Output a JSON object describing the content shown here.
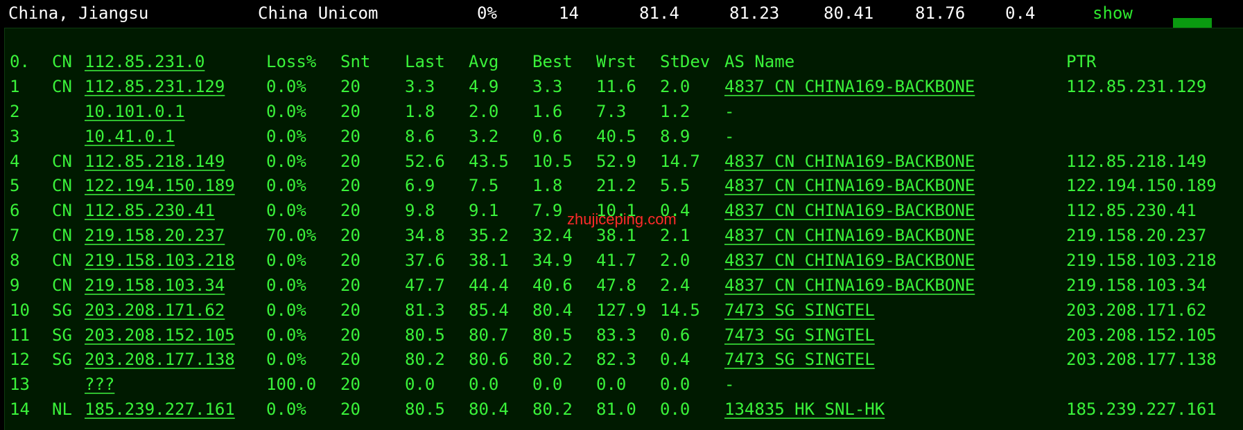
{
  "summary": {
    "location": "China, Jiangsu",
    "isp": "China Unicom",
    "loss": "0%",
    "hops": "14",
    "last": "81.4",
    "avg": "81.23",
    "best": "80.41",
    "worst": "81.76",
    "stdev": "0.4",
    "show_label": "show"
  },
  "header": {
    "index": "0.",
    "cc": "CN",
    "ip": "112.85.231.0",
    "loss": "Loss%",
    "snt": "Snt",
    "last": "Last",
    "avg": "Avg",
    "best": "Best",
    "wrst": "Wrst",
    "stdev": "StDev",
    "asname": "AS Name",
    "ptr": "PTR"
  },
  "hops": [
    {
      "n": "1",
      "cc": "CN",
      "ip": "112.85.231.129",
      "loss": "0.0%",
      "snt": "20",
      "last": "3.3",
      "avg": "4.9",
      "best": "3.3",
      "wrst": "11.6",
      "stdev": "2.0",
      "as": "4837  CN CHINA169-BACKBONE",
      "ptr": "112.85.231.129"
    },
    {
      "n": "2",
      "cc": "",
      "ip": "10.101.0.1",
      "loss": "0.0%",
      "snt": "20",
      "last": "1.8",
      "avg": "2.0",
      "best": "1.6",
      "wrst": "7.3",
      "stdev": "1.2",
      "as": "-",
      "ptr": ""
    },
    {
      "n": "3",
      "cc": "",
      "ip": "10.41.0.1",
      "loss": "0.0%",
      "snt": "20",
      "last": "8.6",
      "avg": "3.2",
      "best": "0.6",
      "wrst": "40.5",
      "stdev": "8.9",
      "as": "-",
      "ptr": ""
    },
    {
      "n": "4",
      "cc": "CN",
      "ip": "112.85.218.149",
      "loss": "0.0%",
      "snt": "20",
      "last": "52.6",
      "avg": "43.5",
      "best": "10.5",
      "wrst": "52.9",
      "stdev": "14.7",
      "as": "4837  CN CHINA169-BACKBONE",
      "ptr": "112.85.218.149"
    },
    {
      "n": "5",
      "cc": "CN",
      "ip": "122.194.150.189",
      "loss": "0.0%",
      "snt": "20",
      "last": "6.9",
      "avg": "7.5",
      "best": "1.8",
      "wrst": "21.2",
      "stdev": "5.5",
      "as": "4837  CN CHINA169-BACKBONE",
      "ptr": "122.194.150.189"
    },
    {
      "n": "6",
      "cc": "CN",
      "ip": "112.85.230.41",
      "loss": "0.0%",
      "snt": "20",
      "last": "9.8",
      "avg": "9.1",
      "best": "7.9",
      "wrst": "10.1",
      "stdev": "0.4",
      "as": "4837  CN CHINA169-BACKBONE",
      "ptr": "112.85.230.41"
    },
    {
      "n": "7",
      "cc": "CN",
      "ip": "219.158.20.237",
      "loss": "70.0%",
      "snt": "20",
      "last": "34.8",
      "avg": "35.2",
      "best": "32.4",
      "wrst": "38.1",
      "stdev": "2.1",
      "as": "4837  CN CHINA169-BACKBONE",
      "ptr": "219.158.20.237"
    },
    {
      "n": "8",
      "cc": "CN",
      "ip": "219.158.103.218",
      "loss": "0.0%",
      "snt": "20",
      "last": "37.6",
      "avg": "38.1",
      "best": "34.9",
      "wrst": "41.7",
      "stdev": "2.0",
      "as": "4837  CN CHINA169-BACKBONE",
      "ptr": "219.158.103.218"
    },
    {
      "n": "9",
      "cc": "CN",
      "ip": "219.158.103.34",
      "loss": "0.0%",
      "snt": "20",
      "last": "47.7",
      "avg": "44.4",
      "best": "40.6",
      "wrst": "47.8",
      "stdev": "2.4",
      "as": "4837  CN CHINA169-BACKBONE",
      "ptr": "219.158.103.34"
    },
    {
      "n": "10",
      "cc": "SG",
      "ip": "203.208.171.62",
      "loss": "0.0%",
      "snt": "20",
      "last": "81.3",
      "avg": "85.4",
      "best": "80.4",
      "wrst": "127.9",
      "stdev": "14.5",
      "as": "7473  SG SINGTEL",
      "ptr": "203.208.171.62"
    },
    {
      "n": "11",
      "cc": "SG",
      "ip": "203.208.152.105",
      "loss": "0.0%",
      "snt": "20",
      "last": "80.5",
      "avg": "80.7",
      "best": "80.5",
      "wrst": "83.3",
      "stdev": "0.6",
      "as": "7473  SG SINGTEL",
      "ptr": "203.208.152.105"
    },
    {
      "n": "12",
      "cc": "SG",
      "ip": "203.208.177.138",
      "loss": "0.0%",
      "snt": "20",
      "last": "80.2",
      "avg": "80.6",
      "best": "80.2",
      "wrst": "82.3",
      "stdev": "0.4",
      "as": "7473  SG SINGTEL",
      "ptr": "203.208.177.138"
    },
    {
      "n": "13",
      "cc": "",
      "ip": "???",
      "loss": "100.0",
      "snt": "20",
      "last": "0.0",
      "avg": "0.0",
      "best": "0.0",
      "wrst": "0.0",
      "stdev": "0.0",
      "as": "-",
      "ptr": ""
    },
    {
      "n": "14",
      "cc": "NL",
      "ip": "185.239.227.161",
      "loss": "0.0%",
      "snt": "20",
      "last": "80.5",
      "avg": "80.4",
      "best": "80.2",
      "wrst": "81.0",
      "stdev": "0.0",
      "as": "134835 HK SNL-HK",
      "ptr": "185.239.227.161"
    }
  ],
  "watermark": "zhujiceping.com",
  "colors": {
    "text": "#3af23a",
    "background": "#001a00",
    "watermark": "#ff2a2a",
    "show": "#2ee82e"
  }
}
